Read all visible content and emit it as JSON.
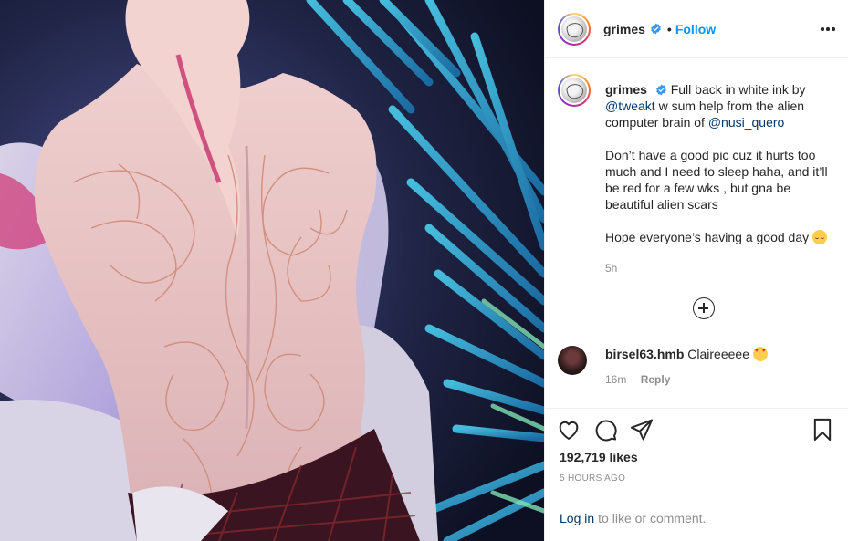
{
  "post": {
    "username": "grimes",
    "verified": true,
    "follow_label": "Follow",
    "dot": "•",
    "more_icon": "more-options-icon"
  },
  "caption": {
    "username": "grimes",
    "line1_pre": "Full back in white ink by",
    "mention1": "@tweakt",
    "line1_mid": "w sum help from the alien computer brain of",
    "mention2": "@nusi_quero",
    "para2": "Don’t have a good pic cuz it hurts too much and I need to sleep haha, and it’ll be red for a few wks , but gna be beautiful alien scars",
    "para3": "Hope everyone’s having a good day",
    "time_ago": "5h"
  },
  "comments": [
    {
      "username": "birsel63.hmb",
      "text": "Claireeeee",
      "time_ago": "16m",
      "reply_label": "Reply"
    }
  ],
  "actions": {
    "icons": [
      "heart-icon",
      "comment-icon",
      "share-icon",
      "bookmark-icon"
    ],
    "likes": "192,719 likes",
    "posted": "5 HOURS AGO"
  },
  "login": {
    "link": "Log in",
    "rest": "to like or comment."
  },
  "colors": {
    "accent": "#0095f6",
    "mention": "#00376b",
    "muted": "#8e8e8e",
    "text": "#262626"
  }
}
